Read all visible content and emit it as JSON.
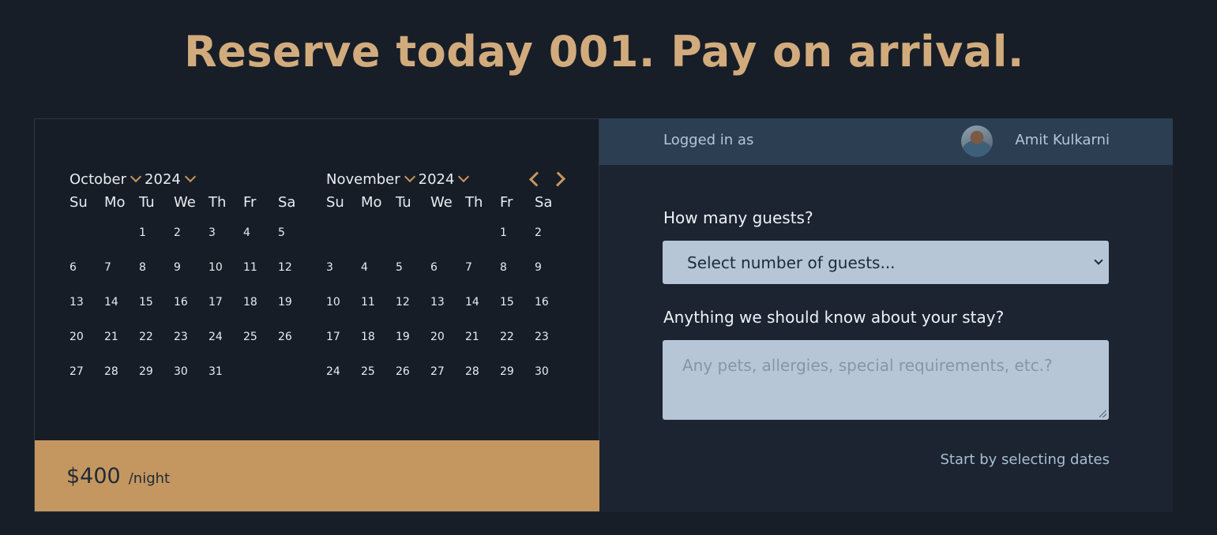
{
  "page": {
    "title": "Reserve today 001. Pay on arrival."
  },
  "calendar": {
    "months": [
      {
        "month": "October",
        "year": "2024",
        "weekdays": [
          "Su",
          "Mo",
          "Tu",
          "We",
          "Th",
          "Fr",
          "Sa"
        ],
        "days": [
          "",
          "",
          "1",
          "2",
          "3",
          "4",
          "5",
          "6",
          "7",
          "8",
          "9",
          "10",
          "11",
          "12",
          "13",
          "14",
          "15",
          "16",
          "17",
          "18",
          "19",
          "20",
          "21",
          "22",
          "23",
          "24",
          "25",
          "26",
          "27",
          "28",
          "29",
          "30",
          "31",
          "",
          ""
        ]
      },
      {
        "month": "November",
        "year": "2024",
        "weekdays": [
          "Su",
          "Mo",
          "Tu",
          "We",
          "Th",
          "Fr",
          "Sa"
        ],
        "days": [
          "",
          "",
          "",
          "",
          "",
          "1",
          "2",
          "3",
          "4",
          "5",
          "6",
          "7",
          "8",
          "9",
          "10",
          "11",
          "12",
          "13",
          "14",
          "15",
          "16",
          "17",
          "18",
          "19",
          "20",
          "21",
          "22",
          "23",
          "24",
          "25",
          "26",
          "27",
          "28",
          "29",
          "30"
        ]
      }
    ],
    "prev_icon": "chevron-left-icon",
    "next_icon": "chevron-right-icon"
  },
  "pricing": {
    "amount": "$400",
    "unit": "/night"
  },
  "login": {
    "label": "Logged in as",
    "user_name": "Amit Kulkarni"
  },
  "form": {
    "guests_label": "How many guests?",
    "guests_placeholder": "Select number of guests...",
    "notes_label": "Anything we should know about your stay?",
    "notes_placeholder": "Any pets, allergies, special requirements, etc.?",
    "start_link": "Start by selecting dates"
  },
  "colors": {
    "background": "#171e27",
    "accent": "#c49760",
    "title": "#d2ab7d",
    "login_bar": "#2c3e52",
    "input_bg": "#b6c6d6"
  }
}
